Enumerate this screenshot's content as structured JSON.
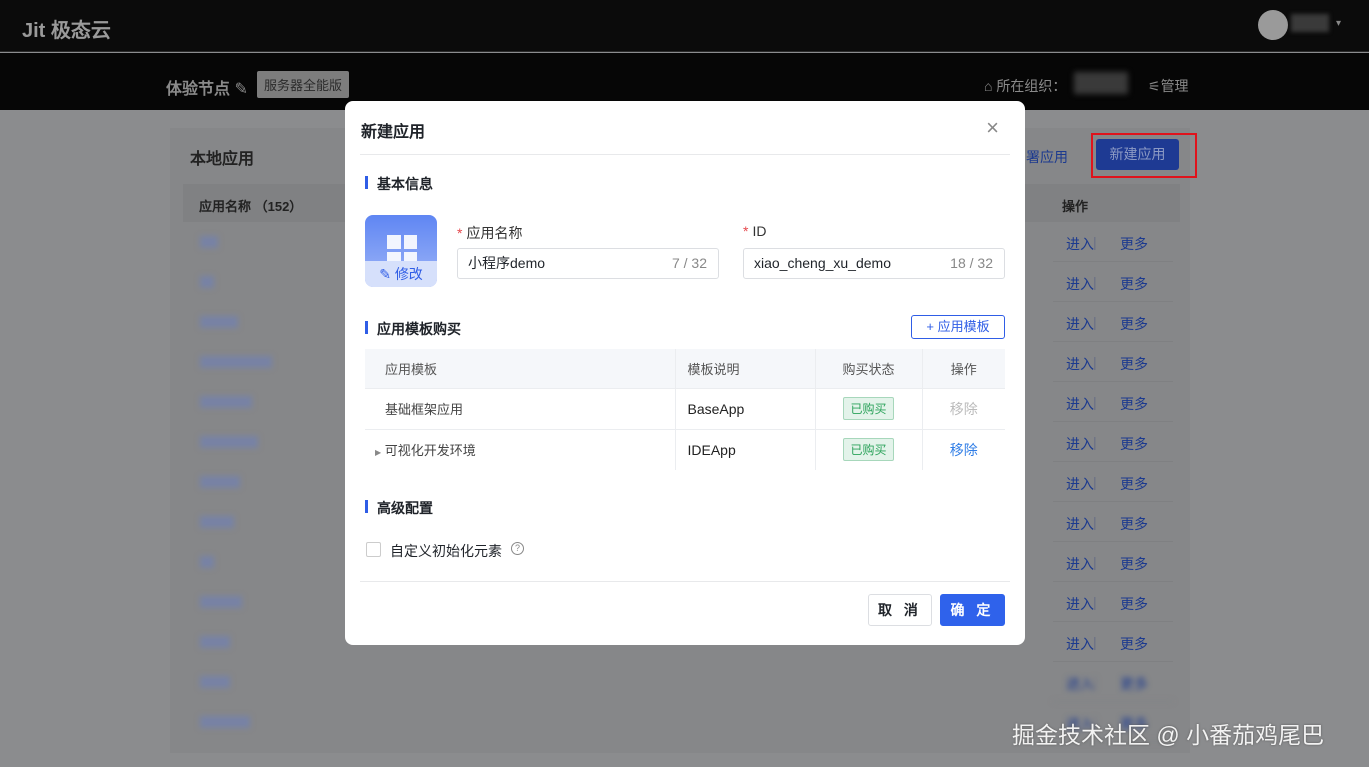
{
  "header": {
    "logo": "Jit 极态云",
    "user_caret": "▾"
  },
  "subheader": {
    "node_title": "体验节点",
    "node_tag": "服务器全能版",
    "org_label": "所在组织：",
    "manage": "管理"
  },
  "page": {
    "card_title": "本地应用",
    "deploy_link": "署应用",
    "new_app_button": "新建应用",
    "col_name": "应用名称 （152）",
    "col_actions": "操作",
    "row_enter": "进入",
    "row_more": "更多"
  },
  "modal": {
    "title": "新建应用",
    "close": "×",
    "basic_section": "基本信息",
    "edit_icon": "修改",
    "name_label": "应用名称",
    "name_value": "小程序demo",
    "name_count": "7 / 32",
    "id_label": "ID",
    "id_value": "xiao_cheng_xu_demo",
    "id_count": "18 / 32",
    "tpl_section": "应用模板购买",
    "add_tpl": "+ 应用模板",
    "tpl_headers": [
      "应用模板",
      "模板说明",
      "购买状态",
      "操作"
    ],
    "tpl_rows": [
      {
        "name": "基础框架应用",
        "desc": "BaseApp",
        "status": "已购买",
        "action": "移除",
        "action_disabled": true
      },
      {
        "name": "可视化开发环境",
        "desc": "IDEApp",
        "status": "已购买",
        "action": "移除",
        "action_disabled": false
      }
    ],
    "adv_section": "高级配置",
    "custom_init": "自定义初始化元素",
    "help": "?",
    "cancel": "取 消",
    "ok": "确 定"
  },
  "watermark": "掘金技术社区 @ 小番茄鸡尾巴"
}
